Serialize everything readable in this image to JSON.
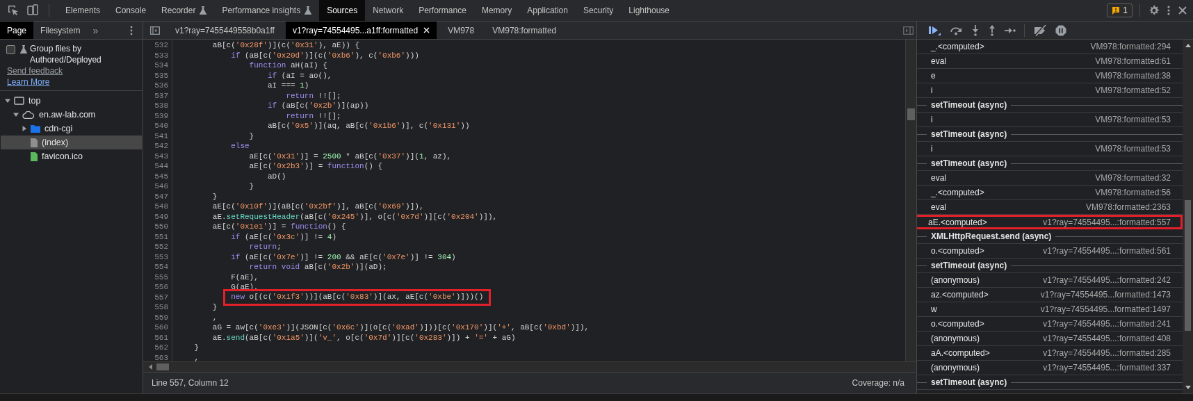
{
  "toolbar": {
    "tabs": [
      {
        "label": "Elements",
        "selected": false,
        "experimental": false
      },
      {
        "label": "Console",
        "selected": false,
        "experimental": false
      },
      {
        "label": "Recorder",
        "selected": false,
        "experimental": true
      },
      {
        "label": "Performance insights",
        "selected": false,
        "experimental": true
      },
      {
        "label": "Sources",
        "selected": true,
        "experimental": false
      },
      {
        "label": "Network",
        "selected": false,
        "experimental": false
      },
      {
        "label": "Performance",
        "selected": false,
        "experimental": false
      },
      {
        "label": "Memory",
        "selected": false,
        "experimental": false
      },
      {
        "label": "Application",
        "selected": false,
        "experimental": false
      },
      {
        "label": "Security",
        "selected": false,
        "experimental": false
      },
      {
        "label": "Lighthouse",
        "selected": false,
        "experimental": false
      }
    ],
    "issues_count": "1"
  },
  "navigator": {
    "tabs": [
      {
        "label": "Page",
        "selected": true
      },
      {
        "label": "Filesystem",
        "selected": false
      }
    ],
    "more": "»",
    "group_files": {
      "label": "Group files by Authored/Deployed",
      "checked": false
    },
    "links": [
      {
        "label": "Send feedback",
        "kind": "muted"
      },
      {
        "label": "Learn More",
        "kind": "primary"
      }
    ],
    "tree": [
      {
        "label": "top",
        "kind": "frame",
        "expanded": true,
        "selected": false,
        "children": [
          {
            "label": "en.aw-lab.com",
            "kind": "domain",
            "expanded": true,
            "selected": false,
            "children": [
              {
                "label": "cdn-cgi",
                "kind": "folder",
                "expanded": false,
                "selected": false
              },
              {
                "label": "(index)",
                "kind": "document",
                "selected": true
              },
              {
                "label": "favicon.ico",
                "kind": "image",
                "selected": false
              }
            ]
          }
        ]
      }
    ]
  },
  "editor": {
    "tabs": [
      {
        "label": "v1?ray=7455449558b0a1ff",
        "selected": false,
        "closable": false
      },
      {
        "label": "v1?ray=74554495...a1ff:formatted",
        "selected": true,
        "closable": true
      },
      {
        "label": "VM978",
        "selected": false,
        "closable": false
      },
      {
        "label": "VM978:formatted",
        "selected": false,
        "closable": false
      }
    ],
    "lines": [
      {
        "number": "532",
        "highlighted": false,
        "tokens": [
          {
            "kind": "plain",
            "text": "        aB[c("
          },
          {
            "kind": "string",
            "text": "'0x28f'"
          },
          {
            "kind": "plain",
            "text": ")](c("
          },
          {
            "kind": "string",
            "text": "'0x31'"
          },
          {
            "kind": "plain",
            "text": "), aE)) {"
          }
        ]
      },
      {
        "number": "533",
        "highlighted": false,
        "tokens": [
          {
            "kind": "keyword",
            "text": "            if"
          },
          {
            "kind": "plain",
            "text": " (aB[c("
          },
          {
            "kind": "string",
            "text": "'0x20d'"
          },
          {
            "kind": "plain",
            "text": ")](c("
          },
          {
            "kind": "string",
            "text": "'0xb6'"
          },
          {
            "kind": "plain",
            "text": "), c("
          },
          {
            "kind": "string",
            "text": "'0xb6'"
          },
          {
            "kind": "plain",
            "text": ")))"
          }
        ]
      },
      {
        "number": "534",
        "highlighted": false,
        "tokens": [
          {
            "kind": "keyword",
            "text": "                function"
          },
          {
            "kind": "plain",
            "text": " aH(aI) {"
          }
        ]
      },
      {
        "number": "535",
        "highlighted": false,
        "tokens": [
          {
            "kind": "keyword",
            "text": "                    if"
          },
          {
            "kind": "plain",
            "text": " (aI = ao(),"
          }
        ]
      },
      {
        "number": "536",
        "highlighted": false,
        "tokens": [
          {
            "kind": "plain",
            "text": "                    aI === "
          },
          {
            "kind": "number",
            "text": "1"
          },
          {
            "kind": "plain",
            "text": ")"
          }
        ]
      },
      {
        "number": "537",
        "highlighted": false,
        "tokens": [
          {
            "kind": "keyword",
            "text": "                        return"
          },
          {
            "kind": "plain",
            "text": " !![];"
          }
        ]
      },
      {
        "number": "538",
        "highlighted": false,
        "tokens": [
          {
            "kind": "keyword",
            "text": "                    if"
          },
          {
            "kind": "plain",
            "text": " (aB[c("
          },
          {
            "kind": "string",
            "text": "'0x2b'"
          },
          {
            "kind": "plain",
            "text": ")](ap))"
          }
        ]
      },
      {
        "number": "539",
        "highlighted": false,
        "tokens": [
          {
            "kind": "keyword",
            "text": "                        return"
          },
          {
            "kind": "plain",
            "text": " !![];"
          }
        ]
      },
      {
        "number": "540",
        "highlighted": false,
        "tokens": [
          {
            "kind": "plain",
            "text": "                    aB[c("
          },
          {
            "kind": "string",
            "text": "'0x5'"
          },
          {
            "kind": "plain",
            "text": ")](aq, aB[c("
          },
          {
            "kind": "string",
            "text": "'0x1b6'"
          },
          {
            "kind": "plain",
            "text": ")], c("
          },
          {
            "kind": "string",
            "text": "'0x131'"
          },
          {
            "kind": "plain",
            "text": "))"
          }
        ]
      },
      {
        "number": "541",
        "highlighted": false,
        "tokens": [
          {
            "kind": "plain",
            "text": "                }"
          }
        ]
      },
      {
        "number": "542",
        "highlighted": false,
        "tokens": [
          {
            "kind": "keyword",
            "text": "            else"
          }
        ]
      },
      {
        "number": "543",
        "highlighted": false,
        "tokens": [
          {
            "kind": "plain",
            "text": "                aE[c("
          },
          {
            "kind": "string",
            "text": "'0x31'"
          },
          {
            "kind": "plain",
            "text": ")] = "
          },
          {
            "kind": "number",
            "text": "2500"
          },
          {
            "kind": "plain",
            "text": " * aB[c("
          },
          {
            "kind": "string",
            "text": "'0x37'"
          },
          {
            "kind": "plain",
            "text": ")]("
          },
          {
            "kind": "number",
            "text": "1"
          },
          {
            "kind": "plain",
            "text": ", az),"
          }
        ]
      },
      {
        "number": "544",
        "highlighted": false,
        "tokens": [
          {
            "kind": "plain",
            "text": "                aE[c("
          },
          {
            "kind": "string",
            "text": "'0x2b3'"
          },
          {
            "kind": "plain",
            "text": ")] = "
          },
          {
            "kind": "keyword",
            "text": "function"
          },
          {
            "kind": "plain",
            "text": "() {"
          }
        ]
      },
      {
        "number": "545",
        "highlighted": false,
        "tokens": [
          {
            "kind": "plain",
            "text": "                    aD()"
          }
        ]
      },
      {
        "number": "546",
        "highlighted": false,
        "tokens": [
          {
            "kind": "plain",
            "text": "                }"
          }
        ]
      },
      {
        "number": "547",
        "highlighted": false,
        "tokens": [
          {
            "kind": "plain",
            "text": "        }"
          }
        ]
      },
      {
        "number": "548",
        "highlighted": false,
        "tokens": [
          {
            "kind": "plain",
            "text": "        aE[c("
          },
          {
            "kind": "string",
            "text": "'0x10f'"
          },
          {
            "kind": "plain",
            "text": ")](aB[c("
          },
          {
            "kind": "string",
            "text": "'0x2bf'"
          },
          {
            "kind": "plain",
            "text": ")], aB[c("
          },
          {
            "kind": "string",
            "text": "'0x69'"
          },
          {
            "kind": "plain",
            "text": ")]),"
          }
        ]
      },
      {
        "number": "549",
        "highlighted": false,
        "tokens": [
          {
            "kind": "plain",
            "text": "        aE."
          },
          {
            "kind": "method",
            "text": "setRequestHeader"
          },
          {
            "kind": "plain",
            "text": "(aB[c("
          },
          {
            "kind": "string",
            "text": "'0x245'"
          },
          {
            "kind": "plain",
            "text": ")], o[c("
          },
          {
            "kind": "string",
            "text": "'0x7d'"
          },
          {
            "kind": "plain",
            "text": ")][c("
          },
          {
            "kind": "string",
            "text": "'0x204'"
          },
          {
            "kind": "plain",
            "text": ")]),"
          }
        ]
      },
      {
        "number": "550",
        "highlighted": false,
        "tokens": [
          {
            "kind": "plain",
            "text": "        aE[c("
          },
          {
            "kind": "string",
            "text": "'0x1e1'"
          },
          {
            "kind": "plain",
            "text": ")] = "
          },
          {
            "kind": "keyword",
            "text": "function"
          },
          {
            "kind": "plain",
            "text": "() {"
          }
        ]
      },
      {
        "number": "551",
        "highlighted": false,
        "tokens": [
          {
            "kind": "keyword",
            "text": "            if"
          },
          {
            "kind": "plain",
            "text": " (aE[c("
          },
          {
            "kind": "string",
            "text": "'0x3c'"
          },
          {
            "kind": "plain",
            "text": ")] != "
          },
          {
            "kind": "number",
            "text": "4"
          },
          {
            "kind": "plain",
            "text": ")"
          }
        ]
      },
      {
        "number": "552",
        "highlighted": false,
        "tokens": [
          {
            "kind": "keyword",
            "text": "                return"
          },
          {
            "kind": "plain",
            "text": ";"
          }
        ]
      },
      {
        "number": "553",
        "highlighted": false,
        "tokens": [
          {
            "kind": "keyword",
            "text": "            if"
          },
          {
            "kind": "plain",
            "text": " (aE[c("
          },
          {
            "kind": "string",
            "text": "'0x7e'"
          },
          {
            "kind": "plain",
            "text": ")] != "
          },
          {
            "kind": "number",
            "text": "200"
          },
          {
            "kind": "plain",
            "text": " && aE[c("
          },
          {
            "kind": "string",
            "text": "'0x7e'"
          },
          {
            "kind": "plain",
            "text": ")] != "
          },
          {
            "kind": "number",
            "text": "304"
          },
          {
            "kind": "plain",
            "text": ")"
          }
        ]
      },
      {
        "number": "554",
        "highlighted": false,
        "tokens": [
          {
            "kind": "keyword",
            "text": "                return void"
          },
          {
            "kind": "plain",
            "text": " aB[c("
          },
          {
            "kind": "string",
            "text": "'0x2b'"
          },
          {
            "kind": "plain",
            "text": ")](aD);"
          }
        ]
      },
      {
        "number": "555",
        "highlighted": false,
        "tokens": [
          {
            "kind": "plain",
            "text": "            F(aE),"
          }
        ]
      },
      {
        "number": "556",
        "highlighted": false,
        "tokens": [
          {
            "kind": "plain",
            "text": "            G(aE),"
          }
        ]
      },
      {
        "number": "557",
        "highlighted": true,
        "tokens": [
          {
            "kind": "keyword",
            "text": "            new"
          },
          {
            "kind": "plain",
            "text": " o[(c("
          },
          {
            "kind": "string",
            "text": "'0x1f3'"
          },
          {
            "kind": "plain",
            "text": "))](aB[c("
          },
          {
            "kind": "string",
            "text": "'0x83'"
          },
          {
            "kind": "plain",
            "text": ")](ax, aE[c("
          },
          {
            "kind": "string",
            "text": "'0xbe'"
          },
          {
            "kind": "plain",
            "text": ")]))()"
          }
        ]
      },
      {
        "number": "558",
        "highlighted": false,
        "tokens": [
          {
            "kind": "plain",
            "text": "        }"
          }
        ]
      },
      {
        "number": "559",
        "highlighted": false,
        "tokens": [
          {
            "kind": "plain",
            "text": "        ,"
          }
        ]
      },
      {
        "number": "560",
        "highlighted": false,
        "tokens": [
          {
            "kind": "plain",
            "text": "        aG = aw[c("
          },
          {
            "kind": "string",
            "text": "'0xe3'"
          },
          {
            "kind": "plain",
            "text": ")](JSON[c("
          },
          {
            "kind": "string",
            "text": "'0x6c'"
          },
          {
            "kind": "plain",
            "text": ")](o[c("
          },
          {
            "kind": "string",
            "text": "'0xad'"
          },
          {
            "kind": "plain",
            "text": ")]))[c("
          },
          {
            "kind": "string",
            "text": "'0x170'"
          },
          {
            "kind": "plain",
            "text": ")]("
          },
          {
            "kind": "string",
            "text": "'+'"
          },
          {
            "kind": "plain",
            "text": ", aB[c("
          },
          {
            "kind": "string",
            "text": "'0xbd'"
          },
          {
            "kind": "plain",
            "text": ")]),"
          }
        ]
      },
      {
        "number": "561",
        "highlighted": false,
        "tokens": [
          {
            "kind": "plain",
            "text": "        aE."
          },
          {
            "kind": "method",
            "text": "send"
          },
          {
            "kind": "plain",
            "text": "(aB[c("
          },
          {
            "kind": "string",
            "text": "'0x1a5'"
          },
          {
            "kind": "plain",
            "text": ")]("
          },
          {
            "kind": "string",
            "text": "'v_'"
          },
          {
            "kind": "plain",
            "text": ", o[c("
          },
          {
            "kind": "string",
            "text": "'0x7d'"
          },
          {
            "kind": "plain",
            "text": ")][c("
          },
          {
            "kind": "string",
            "text": "'0x283'"
          },
          {
            "kind": "plain",
            "text": ")]) + "
          },
          {
            "kind": "string",
            "text": "'='"
          },
          {
            "kind": "plain",
            "text": " + aG)"
          }
        ]
      },
      {
        "number": "562",
        "highlighted": false,
        "tokens": [
          {
            "kind": "plain",
            "text": "    }"
          }
        ]
      },
      {
        "number": "563",
        "highlighted": false,
        "tokens": [
          {
            "kind": "plain",
            "text": "    ,"
          }
        ]
      }
    ],
    "status": {
      "position": "Line 557, Column 12",
      "coverage": "Coverage: n/a"
    }
  },
  "call_stack": [
    {
      "kind": "frame",
      "name": "_.<computed>",
      "location": "VM978:formatted:294",
      "highlighted": false
    },
    {
      "kind": "frame",
      "name": "eval",
      "location": "VM978:formatted:61",
      "highlighted": false
    },
    {
      "kind": "frame",
      "name": "e",
      "location": "VM978:formatted:38",
      "highlighted": false
    },
    {
      "kind": "frame",
      "name": "i",
      "location": "VM978:formatted:52",
      "highlighted": false
    },
    {
      "kind": "async",
      "name": "setTimeout (async)"
    },
    {
      "kind": "frame",
      "name": "i",
      "location": "VM978:formatted:53",
      "highlighted": false
    },
    {
      "kind": "async",
      "name": "setTimeout (async)"
    },
    {
      "kind": "frame",
      "name": "i",
      "location": "VM978:formatted:53",
      "highlighted": false
    },
    {
      "kind": "async",
      "name": "setTimeout (async)"
    },
    {
      "kind": "frame",
      "name": "eval",
      "location": "VM978:formatted:32",
      "highlighted": false
    },
    {
      "kind": "frame",
      "name": "_.<computed>",
      "location": "VM978:formatted:56",
      "highlighted": false
    },
    {
      "kind": "frame",
      "name": "eval",
      "location": "VM978:formatted:2363",
      "highlighted": false
    },
    {
      "kind": "frame",
      "name": "aE.<computed>",
      "location": "v1?ray=74554495...:formatted:557",
      "highlighted": true
    },
    {
      "kind": "async",
      "name": "XMLHttpRequest.send (async)"
    },
    {
      "kind": "frame",
      "name": "o.<computed>",
      "location": "v1?ray=74554495...:formatted:561",
      "highlighted": false
    },
    {
      "kind": "async",
      "name": "setTimeout (async)"
    },
    {
      "kind": "frame",
      "name": "(anonymous)",
      "location": "v1?ray=74554495...:formatted:242",
      "highlighted": false
    },
    {
      "kind": "frame",
      "name": "az.<computed>",
      "location": "v1?ray=74554495...formatted:1473",
      "highlighted": false
    },
    {
      "kind": "frame",
      "name": "w",
      "location": "v1?ray=74554495...formatted:1497",
      "highlighted": false
    },
    {
      "kind": "frame",
      "name": "o.<computed>",
      "location": "v1?ray=74554495...:formatted:241",
      "highlighted": false
    },
    {
      "kind": "frame",
      "name": "(anonymous)",
      "location": "v1?ray=74554495...:formatted:408",
      "highlighted": false
    },
    {
      "kind": "frame",
      "name": "aA.<computed>",
      "location": "v1?ray=74554495...:formatted:285",
      "highlighted": false
    },
    {
      "kind": "frame",
      "name": "(anonymous)",
      "location": "v1?ray=74554495...:formatted:337",
      "highlighted": false
    },
    {
      "kind": "async",
      "name": "setTimeout (async)"
    }
  ]
}
